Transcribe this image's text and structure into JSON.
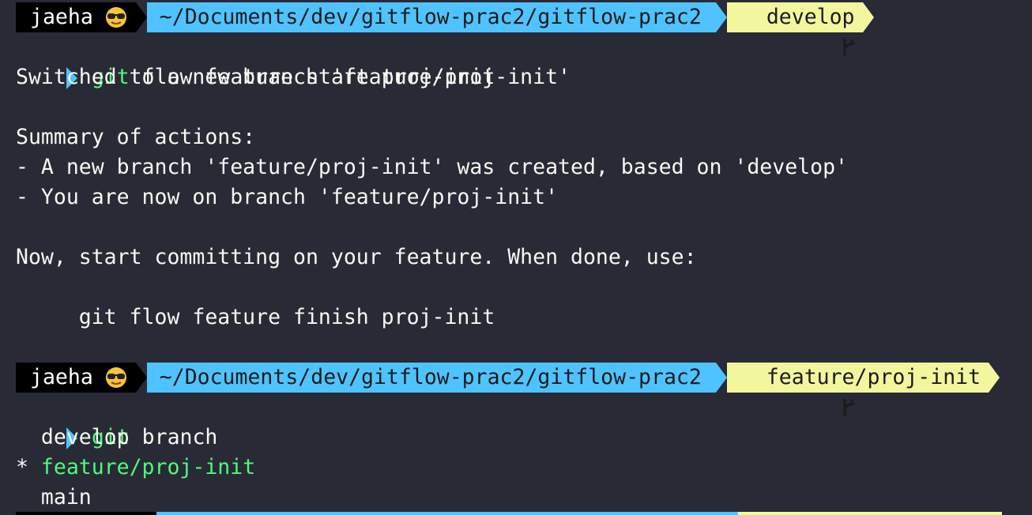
{
  "prompt1": {
    "user": "jaeha",
    "path": "~/Documents/dev/gitflow-prac2/gitflow-prac2",
    "branch": "develop"
  },
  "cmd1": {
    "program": "git",
    "args": " flow feature start proj-init"
  },
  "output1": {
    "line1": "Switched to a new branch 'feature/proj-init'",
    "line2": "Summary of actions:",
    "line3": "- A new branch 'feature/proj-init' was created, based on 'develop'",
    "line4": "- You are now on branch 'feature/proj-init'",
    "line5": "Now, start committing on your feature. When done, use:",
    "line6": "     git flow feature finish proj-init"
  },
  "prompt2": {
    "user": "jaeha",
    "path": "~/Documents/dev/gitflow-prac2/gitflow-prac2",
    "branch": "feature/proj-init"
  },
  "cmd2": {
    "program": "git",
    "args": " branch"
  },
  "branches": {
    "b1": "  develop",
    "b2_marker": "* ",
    "b2_name": "feature/proj-init",
    "b3": "  main"
  },
  "colors": {
    "background": "#282a36",
    "user_segment": "#000000",
    "path_segment": "#4fc3ff",
    "git_segment": "#f2f79e",
    "command": "#50fa7b",
    "current_branch": "#50fa7b"
  },
  "icons": {
    "user": "sunglasses-emoji-icon",
    "branch": "git-branch-icon",
    "caret": "prompt-caret-icon"
  }
}
